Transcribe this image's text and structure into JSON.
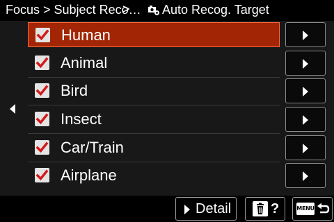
{
  "header": {
    "crumb1": "Focus > Subject Reco…",
    "sep": ">",
    "crumb2": "Auto Recog. Target",
    "crumb2_icon": "camera-settings-icon"
  },
  "items": [
    {
      "label": "Human",
      "checked": true,
      "selected": true
    },
    {
      "label": "Animal",
      "checked": true,
      "selected": false
    },
    {
      "label": "Bird",
      "checked": true,
      "selected": false
    },
    {
      "label": "Insect",
      "checked": true,
      "selected": false
    },
    {
      "label": "Car/Train",
      "checked": true,
      "selected": false
    },
    {
      "label": "Airplane",
      "checked": true,
      "selected": false
    }
  ],
  "footer": {
    "detail_label": "Detail",
    "trash_label": "?",
    "menu_label": "MENU"
  },
  "colors": {
    "selected_bg": "#a22606",
    "check_red": "#d21a1a"
  }
}
